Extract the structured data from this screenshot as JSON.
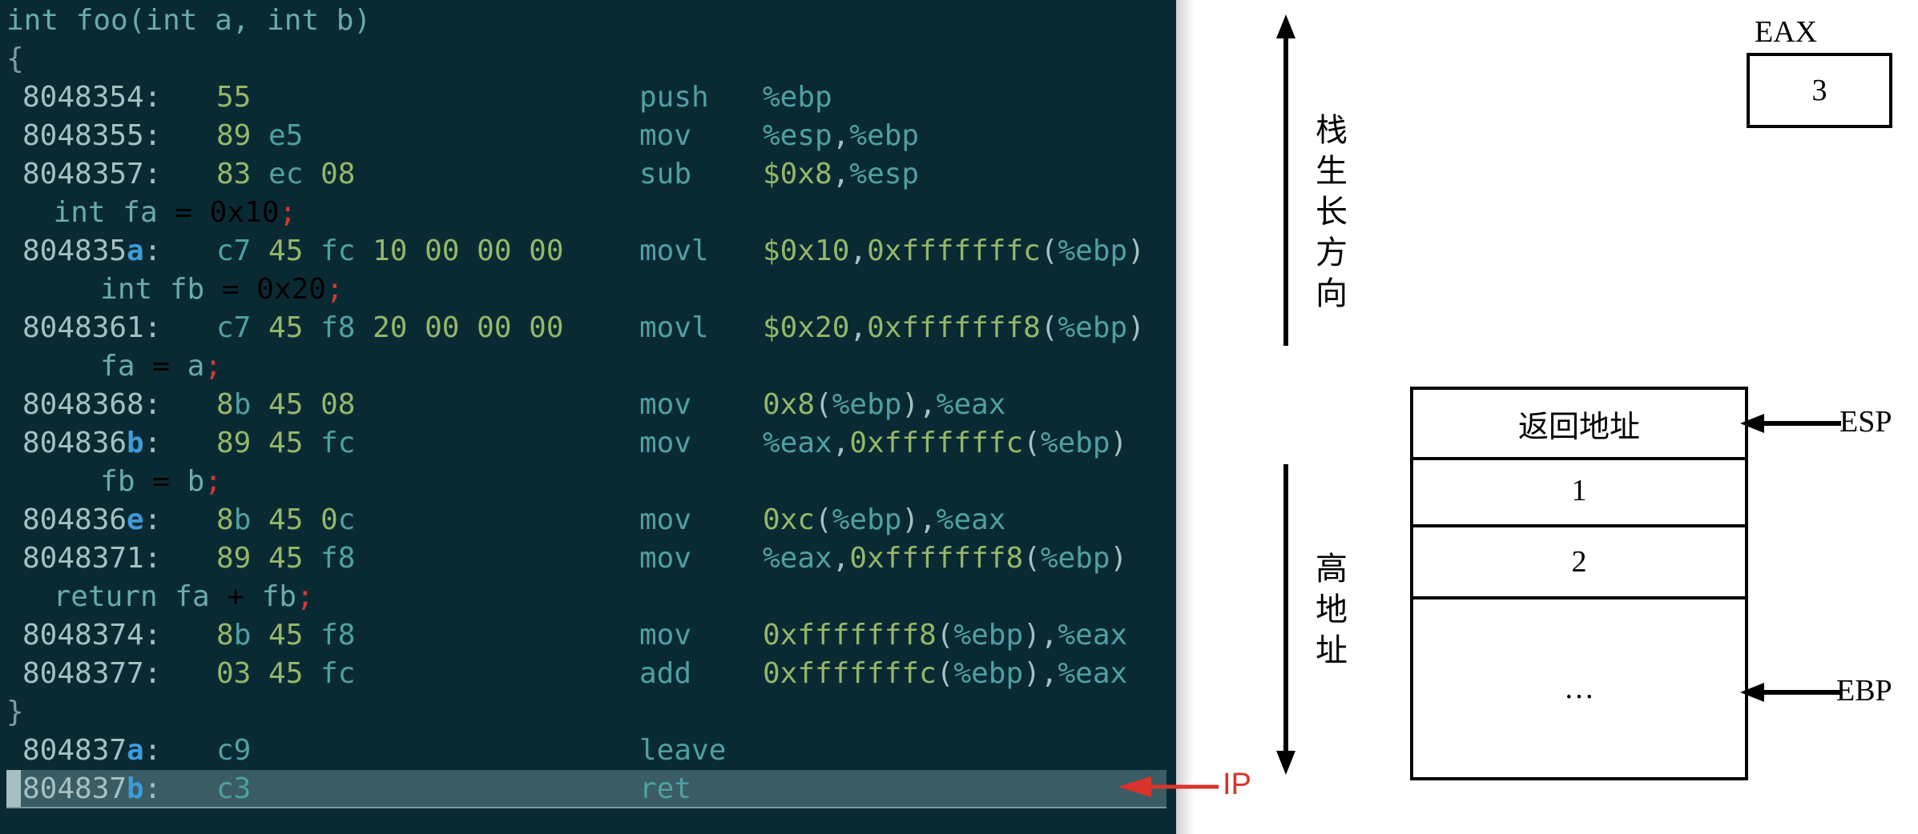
{
  "code": {
    "lines": [
      {
        "kind": "src",
        "indent": 0,
        "text": "int foo(int a, int b)"
      },
      {
        "kind": "brace",
        "indent": 0,
        "text": "{"
      },
      {
        "kind": "asm",
        "addr_base": "8048354",
        "addr_suffix": "",
        "bytes": [
          {
            "t": "55",
            "c": "g"
          }
        ],
        "mnemonic": "push",
        "operands": [
          {
            "t": "%ebp",
            "c": "r"
          }
        ]
      },
      {
        "kind": "asm",
        "addr_base": "8048355",
        "addr_suffix": "",
        "bytes": [
          {
            "t": "89",
            "c": "g"
          },
          {
            "t": " e5",
            "c": "b"
          }
        ],
        "mnemonic": "mov",
        "operands": [
          {
            "t": "%esp",
            "c": "r"
          },
          {
            "t": ",",
            "c": "p"
          },
          {
            "t": "%ebp",
            "c": "r"
          }
        ]
      },
      {
        "kind": "asm",
        "addr_base": "8048357",
        "addr_suffix": "",
        "bytes": [
          {
            "t": "83",
            "c": "g"
          },
          {
            "t": " ec ",
            "c": "b"
          },
          {
            "t": "08",
            "c": "g"
          }
        ],
        "mnemonic": "sub",
        "operands": [
          {
            "t": "$0x8",
            "c": "g"
          },
          {
            "t": ",",
            "c": "p"
          },
          {
            "t": "%esp",
            "c": "r"
          }
        ]
      },
      {
        "kind": "src",
        "indent": 2,
        "text": "int fa = 0x10",
        "semi": ";"
      },
      {
        "kind": "asm",
        "addr_base": "804835",
        "addr_suffix": "a",
        "bytes": [
          {
            "t": "c7",
            "c": "b"
          },
          {
            "t": " 45 ",
            "c": "g"
          },
          {
            "t": "fc",
            "c": "b"
          },
          {
            "t": " 10 00 00 00",
            "c": "g"
          }
        ],
        "mnemonic": "movl",
        "operands": [
          {
            "t": "$0x10",
            "c": "g"
          },
          {
            "t": ",",
            "c": "p"
          },
          {
            "t": "0xfffffffc",
            "c": "g"
          },
          {
            "t": "(",
            "c": "p"
          },
          {
            "t": "%ebp",
            "c": "r"
          },
          {
            "t": ")",
            "c": "p"
          }
        ]
      },
      {
        "kind": "src",
        "indent": 4,
        "text": "int fb = 0x20",
        "semi": ";"
      },
      {
        "kind": "asm",
        "addr_base": "8048361",
        "addr_suffix": "",
        "bytes": [
          {
            "t": "c7",
            "c": "b"
          },
          {
            "t": " 45 ",
            "c": "g"
          },
          {
            "t": "f8",
            "c": "b"
          },
          {
            "t": " 20 00 00 00",
            "c": "g"
          }
        ],
        "mnemonic": "movl",
        "operands": [
          {
            "t": "$0x20",
            "c": "g"
          },
          {
            "t": ",",
            "c": "p"
          },
          {
            "t": "0xfffffff8",
            "c": "g"
          },
          {
            "t": "(",
            "c": "p"
          },
          {
            "t": "%ebp",
            "c": "r"
          },
          {
            "t": ")",
            "c": "p"
          }
        ]
      },
      {
        "kind": "src",
        "indent": 4,
        "text": "fa = a",
        "semi": ";"
      },
      {
        "kind": "asm",
        "addr_base": "8048368",
        "addr_suffix": "",
        "bytes": [
          {
            "t": "8",
            "c": "g"
          },
          {
            "t": "b",
            "c": "b"
          },
          {
            "t": " 45 08",
            "c": "g"
          }
        ],
        "mnemonic": "mov",
        "operands": [
          {
            "t": "0x8",
            "c": "g"
          },
          {
            "t": "(",
            "c": "p"
          },
          {
            "t": "%ebp",
            "c": "r"
          },
          {
            "t": "),",
            "c": "p"
          },
          {
            "t": "%eax",
            "c": "r"
          }
        ]
      },
      {
        "kind": "asm",
        "addr_base": "804836",
        "addr_suffix": "b",
        "bytes": [
          {
            "t": "89 45 ",
            "c": "g"
          },
          {
            "t": "fc",
            "c": "b"
          }
        ],
        "mnemonic": "mov",
        "operands": [
          {
            "t": "%eax",
            "c": "r"
          },
          {
            "t": ",",
            "c": "p"
          },
          {
            "t": "0xfffffffc",
            "c": "g"
          },
          {
            "t": "(",
            "c": "p"
          },
          {
            "t": "%ebp",
            "c": "r"
          },
          {
            "t": ")",
            "c": "p"
          }
        ]
      },
      {
        "kind": "src",
        "indent": 4,
        "text": "fb = b",
        "semi": ";"
      },
      {
        "kind": "asm",
        "addr_base": "804836",
        "addr_suffix": "e",
        "bytes": [
          {
            "t": "8",
            "c": "g"
          },
          {
            "t": "b",
            "c": "b"
          },
          {
            "t": " 45 0",
            "c": "g"
          },
          {
            "t": "c",
            "c": "b"
          }
        ],
        "mnemonic": "mov",
        "operands": [
          {
            "t": "0xc",
            "c": "g"
          },
          {
            "t": "(",
            "c": "p"
          },
          {
            "t": "%ebp",
            "c": "r"
          },
          {
            "t": "),",
            "c": "p"
          },
          {
            "t": "%eax",
            "c": "r"
          }
        ]
      },
      {
        "kind": "asm",
        "addr_base": "8048371",
        "addr_suffix": "",
        "bytes": [
          {
            "t": "89 45 ",
            "c": "g"
          },
          {
            "t": "f8",
            "c": "b"
          }
        ],
        "mnemonic": "mov",
        "operands": [
          {
            "t": "%eax",
            "c": "r"
          },
          {
            "t": ",",
            "c": "p"
          },
          {
            "t": "0xfffffff8",
            "c": "g"
          },
          {
            "t": "(",
            "c": "p"
          },
          {
            "t": "%ebp",
            "c": "r"
          },
          {
            "t": ")",
            "c": "p"
          }
        ]
      },
      {
        "kind": "src",
        "indent": 2,
        "text": "return fa + fb",
        "semi": ";"
      },
      {
        "kind": "asm",
        "addr_base": "8048374",
        "addr_suffix": "",
        "bytes": [
          {
            "t": "8",
            "c": "g"
          },
          {
            "t": "b",
            "c": "b"
          },
          {
            "t": " 45 ",
            "c": "g"
          },
          {
            "t": "f8",
            "c": "b"
          }
        ],
        "mnemonic": "mov",
        "operands": [
          {
            "t": "0xfffffff8",
            "c": "g"
          },
          {
            "t": "(",
            "c": "p"
          },
          {
            "t": "%ebp",
            "c": "r"
          },
          {
            "t": "),",
            "c": "p"
          },
          {
            "t": "%eax",
            "c": "r"
          }
        ]
      },
      {
        "kind": "asm",
        "addr_base": "8048377",
        "addr_suffix": "",
        "bytes": [
          {
            "t": "03 45 ",
            "c": "g"
          },
          {
            "t": "fc",
            "c": "b"
          }
        ],
        "mnemonic": "add",
        "operands": [
          {
            "t": "0xfffffffc",
            "c": "g"
          },
          {
            "t": "(",
            "c": "p"
          },
          {
            "t": "%ebp",
            "c": "r"
          },
          {
            "t": "),",
            "c": "p"
          },
          {
            "t": "%eax",
            "c": "r"
          }
        ]
      },
      {
        "kind": "brace",
        "indent": 0,
        "text": "}"
      },
      {
        "kind": "asm",
        "addr_base": "804837",
        "addr_suffix": "a",
        "bytes": [
          {
            "t": "c9",
            "c": "b"
          }
        ],
        "mnemonic": "leave",
        "operands": []
      },
      {
        "kind": "asm",
        "addr_base": "804837",
        "addr_suffix": "b",
        "bytes": [
          {
            "t": "c3",
            "c": "b"
          }
        ],
        "mnemonic": "ret",
        "operands": [],
        "current": true
      }
    ],
    "ip_label": "IP"
  },
  "diagram": {
    "growth_label": "栈生长方向",
    "high_addr_label": "高地址",
    "register": {
      "name": "EAX",
      "value": "3"
    },
    "stack_cells": [
      "返回地址",
      "1",
      "2",
      "…"
    ],
    "esp_label": "ESP",
    "ebp_label": "EBP"
  },
  "colors": {
    "code_bg": "#0a2a33",
    "current_line_bg": "#3a5c64",
    "ip_arrow": "#d9342b"
  }
}
